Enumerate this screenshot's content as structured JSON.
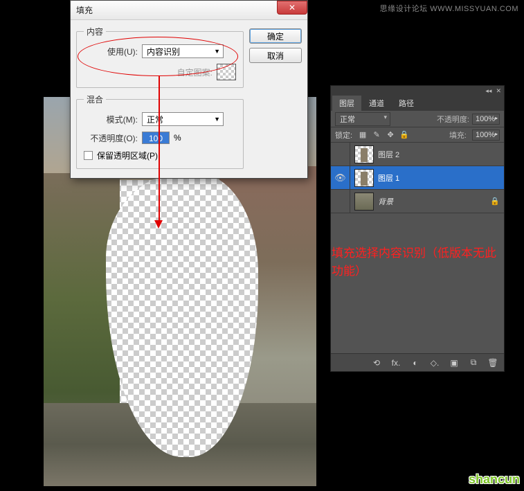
{
  "watermark_top": "思缘设计论坛 WWW.MISSYUAN.COM",
  "watermark_bottom": "shancun",
  "dialog": {
    "title": "填充",
    "ok": "确定",
    "cancel": "取消",
    "content_group": "内容",
    "use_label": "使用(U):",
    "use_value": "内容识别",
    "pattern_label": "自定图案:",
    "blend_group": "混合",
    "mode_label": "模式(M):",
    "mode_value": "正常",
    "opacity_label": "不透明度(O):",
    "opacity_value": "100",
    "opacity_unit": "%",
    "preserve_label": "保留透明区域(P)"
  },
  "layers": {
    "tabs": [
      "图层",
      "通道",
      "路径"
    ],
    "blend_mode": "正常",
    "opacity_label": "不透明度:",
    "opacity_value": "100%",
    "lock_label": "锁定:",
    "fill_label": "填充:",
    "fill_value": "100%",
    "items": [
      {
        "name": "图层 2",
        "visible": false,
        "thumb": "trans",
        "selected": false,
        "locked": false
      },
      {
        "name": "图层 1",
        "visible": true,
        "thumb": "trans",
        "selected": true,
        "locked": false
      },
      {
        "name": "背景",
        "visible": false,
        "thumb": "solid",
        "selected": false,
        "locked": true,
        "italic": true
      }
    ],
    "footer_icons": [
      "⟲",
      "fx.",
      "◐",
      "◇.",
      "▣",
      "⧉",
      "🗑"
    ]
  },
  "annotation": "填充选择内容识别（低版本无此功能）"
}
